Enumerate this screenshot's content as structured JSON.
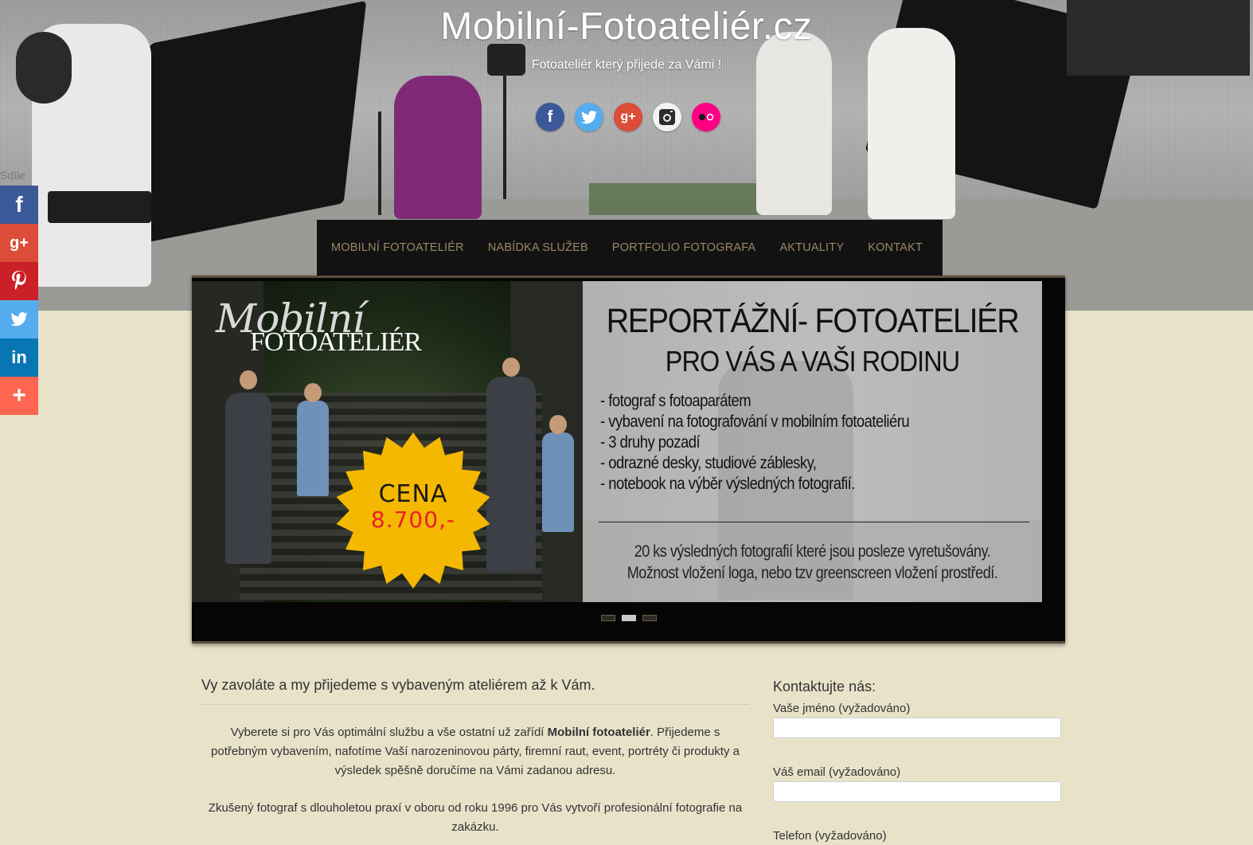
{
  "header": {
    "title": "Mobilní-Fotoateliér.cz",
    "tagline": "Fotoateliér který přijede za Vámi !",
    "social_icons": [
      {
        "name": "facebook-icon",
        "glyph": "f"
      },
      {
        "name": "twitter-icon",
        "glyph": "t"
      },
      {
        "name": "google-plus-icon",
        "glyph": "g+"
      },
      {
        "name": "instagram-icon",
        "glyph": "◙"
      },
      {
        "name": "flickr-icon",
        "glyph": "●○"
      }
    ]
  },
  "nav": {
    "items": [
      "MOBILNÍ FOTOATELIÉR",
      "NABÍDKA SLUŽEB",
      "PORTFOLIO FOTOGRAFA",
      "AKTUALITY",
      "KONTAKT"
    ]
  },
  "share": {
    "label": "Sdíle",
    "buttons": [
      {
        "name": "share-facebook-button",
        "glyph": "f"
      },
      {
        "name": "share-google-plus-button",
        "glyph": "g+"
      },
      {
        "name": "share-pinterest-button",
        "glyph": "P"
      },
      {
        "name": "share-twitter-button",
        "glyph": "t"
      },
      {
        "name": "share-linkedin-button",
        "glyph": "in"
      },
      {
        "name": "share-more-button",
        "glyph": "+"
      }
    ]
  },
  "slider": {
    "logo_line1": "Mobilní",
    "logo_line2": "FOTOATELIÉR",
    "price_label": "CENA",
    "price_value": "8.700,-",
    "heading1": "REPORTÁŽNÍ- FOTOATELIÉR",
    "heading2": "PRO VÁS A VAŠI RODINU",
    "items": [
      "- fotograf s fotoaparátem",
      "- vybavení na fotografování v mobilním fotoateliéru",
      "- 3 druhy pozadí",
      "- odrazné desky, studiové záblesky,",
      "- notebook na výběr výsledných fotografií."
    ],
    "footer1": "20 ks výsledných fotografií které jsou posleze vyretušovány.",
    "footer2": "Možnost vložení loga, nebo tzv greenscreen vložení prostředí.",
    "slide_count": 3,
    "active_slide": 2
  },
  "main": {
    "heading": "Vy zavoláte a my přijedeme s vybaveným ateliérem až k Vám.",
    "p1_before": "Vyberete si pro Vás optimální službu a vše ostatní už zařídí ",
    "p1_bold": "Mobilní fotoateliér",
    "p1_after": ". Přijedeme s potřebným vybavením, nafotíme Vaší narozeninovou párty, firemní raut, event, portréty či produkty a výsledek spěšně doručíme na Vámi zadanou adresu.",
    "p2": "Zkušený fotograf s dlouholetou praxí v oboru od roku 1996 pro Vás vytvoří profesionální fotografie na zakázku."
  },
  "sidebar": {
    "heading": "Kontaktujte nás:",
    "name_label": "Vaše jméno (vyžadováno)",
    "name_value": "",
    "email_label": "Váš email (vyžadováno)",
    "email_value": "",
    "phone_label": "Telefon (vyžadováno)"
  },
  "colors": {
    "page_bg": "#e8e2c9",
    "nav_bg": "#121212",
    "nav_text": "#9a8865",
    "price_burst": "#f4b800",
    "price_value": "#e8202a"
  }
}
